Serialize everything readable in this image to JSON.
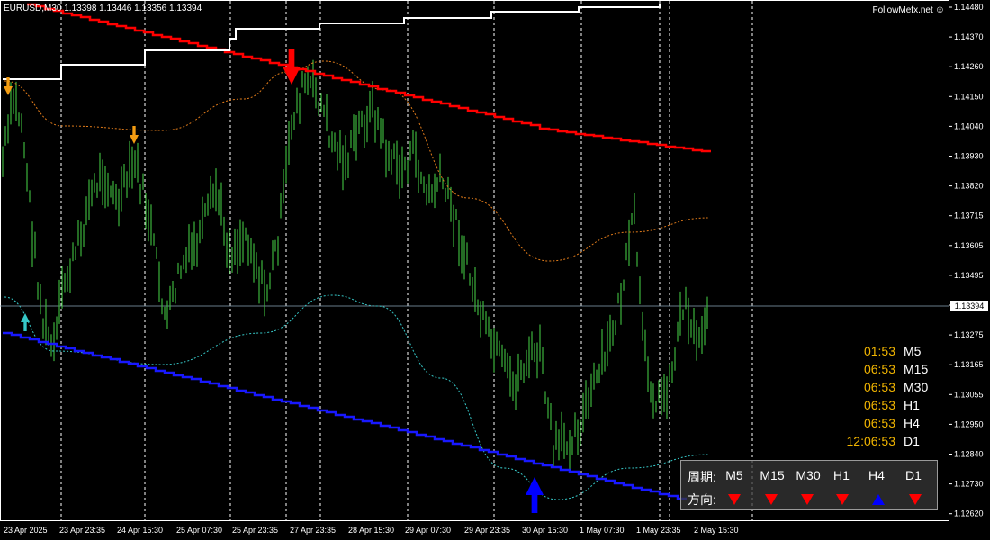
{
  "symbol_header": "EURUSD,M30  1.13398 1.13446 1.13356 1.13394",
  "brand": "FollowMefx.net",
  "brand_icon": "smiley-icon",
  "current_price": "1.13394",
  "price_axis": [
    "1.14480",
    "1.14370",
    "1.14260",
    "1.14150",
    "1.14040",
    "1.13930",
    "1.13820",
    "1.13715",
    "1.13605",
    "1.13495",
    "1.13385",
    "1.13275",
    "1.13165",
    "1.13055",
    "1.12950",
    "1.12840",
    "1.12730",
    "1.12620"
  ],
  "time_axis": [
    "23 Apr 2025",
    "23 Apr 23:35",
    "24 Apr 15:30",
    "25 Apr 07:30",
    "25 Apr 23:35",
    "27 Apr 23:35",
    "28 Apr 15:30",
    "29 Apr 07:30",
    "29 Apr 23:35",
    "30 Apr 15:30",
    "1 May 07:30",
    "1 May 23:35",
    "2 May 15:30",
    "5 May 07:30"
  ],
  "timers": [
    {
      "time": "01:53",
      "tf": "M5"
    },
    {
      "time": "06:53",
      "tf": "M15"
    },
    {
      "time": "06:53",
      "tf": "M30"
    },
    {
      "time": "06:53",
      "tf": "H1"
    },
    {
      "time": "06:53",
      "tf": "H4"
    },
    {
      "time": "12:06:53",
      "tf": "D1"
    }
  ],
  "trend_panel": {
    "period_label": "周期:",
    "direction_label": "方向:",
    "columns": [
      {
        "tf": "M5",
        "dir": "down"
      },
      {
        "tf": "M15",
        "dir": "down"
      },
      {
        "tf": "M30",
        "dir": "down"
      },
      {
        "tf": "H1",
        "dir": "down"
      },
      {
        "tf": "H4",
        "dir": "up"
      },
      {
        "tf": "D1",
        "dir": "down"
      }
    ]
  },
  "colors": {
    "candle": "#3db33d",
    "upper_band": "#ff0000",
    "lower_band": "#1818ff",
    "step_line": "#ffffff",
    "orange_dots": "#e07b1a",
    "cyan_dots": "#36c8c8",
    "grid": "#ffffff",
    "up": "#0000ff",
    "down": "#ff0000"
  }
}
